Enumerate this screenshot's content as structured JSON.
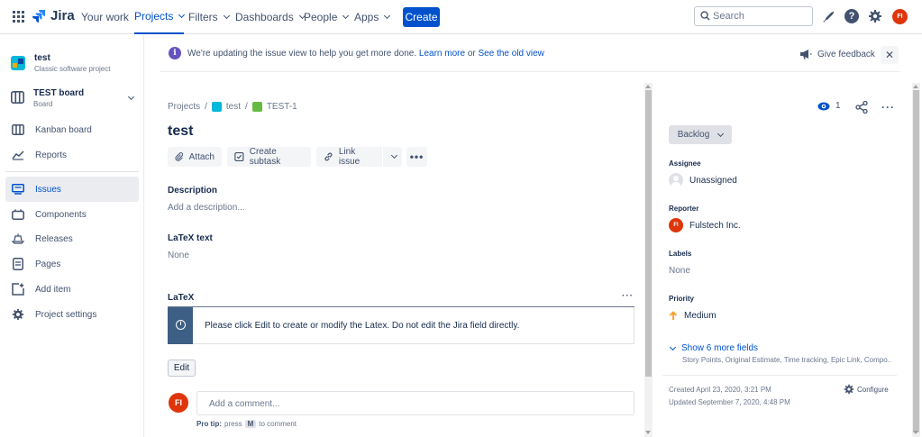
{
  "nav": {
    "logo_text": "Jira",
    "items": [
      {
        "label": "Your work",
        "has_dropdown": false,
        "active": false
      },
      {
        "label": "Projects",
        "has_dropdown": true,
        "active": true
      },
      {
        "label": "Filters",
        "has_dropdown": true,
        "active": false
      },
      {
        "label": "Dashboards",
        "has_dropdown": true,
        "active": false
      },
      {
        "label": "People",
        "has_dropdown": true,
        "active": false
      },
      {
        "label": "Apps",
        "has_dropdown": true,
        "active": false
      }
    ],
    "create_label": "Create",
    "search_placeholder": "Search",
    "avatar_initials": "FI"
  },
  "sidebar": {
    "project_name": "test",
    "project_type": "Classic software project",
    "board_name": "TEST board",
    "board_type": "Board",
    "items": [
      {
        "label": "Kanban board",
        "icon": "kanban-icon"
      },
      {
        "label": "Reports",
        "icon": "reports-icon"
      },
      {
        "label": "Issues",
        "icon": "issues-icon",
        "active": true
      },
      {
        "label": "Components",
        "icon": "components-icon"
      },
      {
        "label": "Releases",
        "icon": "releases-icon"
      },
      {
        "label": "Pages",
        "icon": "pages-icon"
      },
      {
        "label": "Add item",
        "icon": "add-item-icon"
      },
      {
        "label": "Project settings",
        "icon": "gear-icon"
      }
    ]
  },
  "banner": {
    "text": "We're updating the issue view to help you get more done.",
    "learn_more": "Learn more",
    "or": "or",
    "old_view": "See the old view",
    "feedback": "Give feedback"
  },
  "issue": {
    "breadcrumb": [
      "Projects",
      "test",
      "TEST-1"
    ],
    "title": "test",
    "toolbar": {
      "attach": "Attach",
      "create_subtask": "Create subtask",
      "link_issue": "Link issue"
    },
    "description_label": "Description",
    "description_placeholder": "Add a description...",
    "latex_text_label": "LaTeX text",
    "latex_text_value": "None",
    "latex_label": "LaTeX",
    "latex_message": "Please click Edit to create or modify the Latex. Do not edit the Jira field directly.",
    "edit_label": "Edit",
    "comment_avatar": "FI",
    "comment_placeholder": "Add a comment...",
    "protip_label": "Pro tip:",
    "protip_press": "press",
    "protip_key": "M",
    "protip_rest": "to comment"
  },
  "details": {
    "watch_count": "1",
    "status": "Backlog",
    "assignee_label": "Assignee",
    "assignee_value": "Unassigned",
    "reporter_label": "Reporter",
    "reporter_value": "Fulstech Inc.",
    "reporter_initials": "FI",
    "labels_label": "Labels",
    "labels_value": "None",
    "priority_label": "Priority",
    "priority_value": "Medium",
    "show_more": "Show 6 more fields",
    "show_more_sub": "Story Points, Original Estimate, Time tracking, Epic Link, Compo...",
    "created": "Created April 23, 2020, 3:21 PM",
    "updated": "Updated September 7, 2020, 4:48 PM",
    "configure": "Configure"
  },
  "colors": {
    "brand_blue": "#0052cc",
    "avatar_red": "#de350b",
    "priority_orange": "#ff991f",
    "latex_panel": "#3e5f85"
  }
}
